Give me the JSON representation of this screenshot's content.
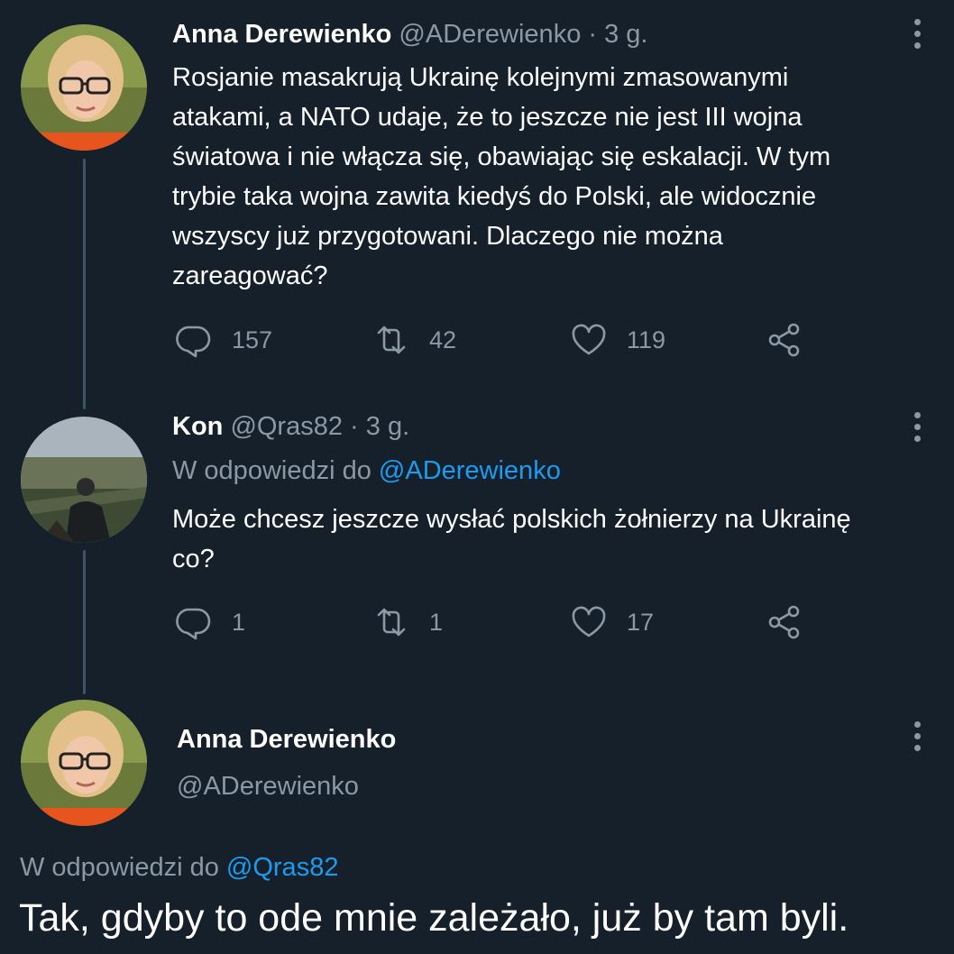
{
  "tweet1": {
    "name": "Anna Derewienko",
    "handle": "@ADerewienko",
    "time": "· 3 g.",
    "lines": [
      "Rosjanie masakrują Ukrainę kolejnymi zmasowanymi",
      "atakami, a NATO udaje, że to jeszcze nie jest III wojna",
      "światowa i nie włącza się, obawiając się eskalacji. W tym",
      "trybie taka wojna zawita kiedyś do Polski, ale widocznie",
      "wszyscy już przygotowani. Dlaczego nie można",
      "zareagować?"
    ],
    "replies": "157",
    "retweets": "42",
    "likes": "119"
  },
  "tweet2": {
    "name": "Kon",
    "handle": "@Qras82",
    "time": "· 3 g.",
    "reply_prefix": "W odpowiedzi do",
    "reply_to": "@ADerewienko",
    "lines": [
      "Może chcesz jeszcze wysłać polskich żołnierzy na Ukrainę",
      "co?"
    ],
    "replies": "1",
    "retweets": "1",
    "likes": "17"
  },
  "tweet3": {
    "name": "Anna Derewienko",
    "handle": "@ADerewienko",
    "reply_prefix": "W odpowiedzi do",
    "reply_to": "@Qras82",
    "text": "Tak, gdyby to ode mnie zależało, już by tam byli."
  },
  "icons": [
    "reply-icon",
    "retweet-icon",
    "like-icon",
    "share-icon",
    "more-icon"
  ],
  "colors": {
    "background": "#15202b",
    "muted": "#8b98a5",
    "link": "#1d9bf0",
    "thread": "#3d5466"
  }
}
